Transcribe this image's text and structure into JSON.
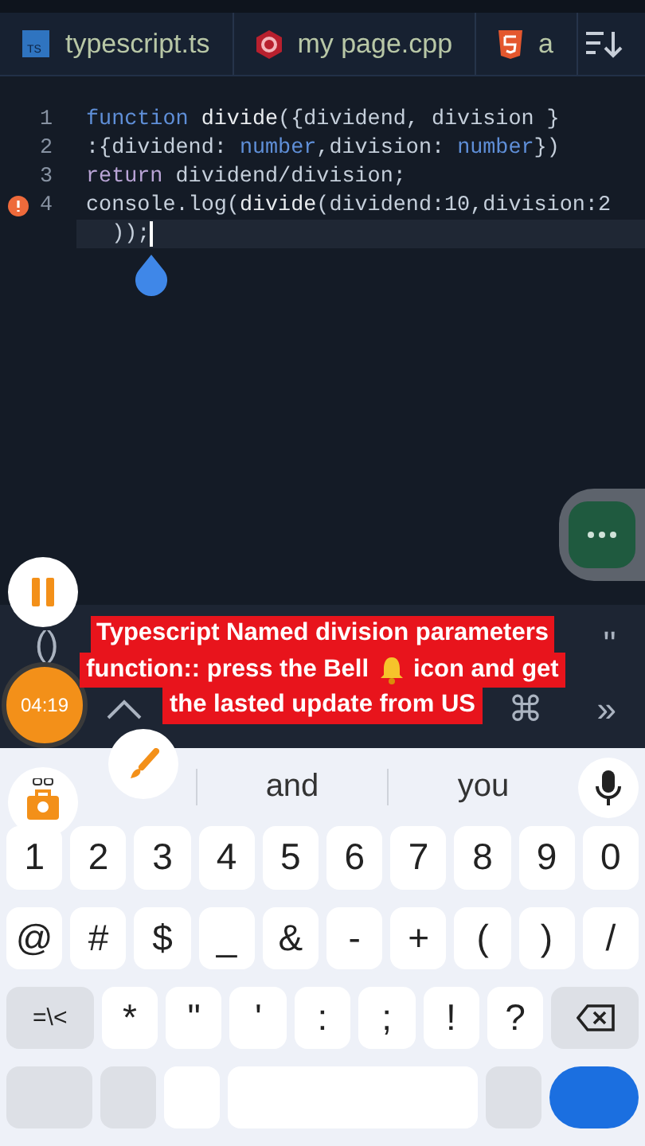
{
  "tabs": [
    {
      "label": "typescript.ts",
      "kind": "ts",
      "icon_text": "TS"
    },
    {
      "label": "my page.cpp",
      "kind": "cpp"
    },
    {
      "label": "a",
      "kind": "html"
    }
  ],
  "editor": {
    "lines": [
      {
        "number": "1",
        "error": false,
        "current": false,
        "tokens": [
          {
            "t": "function ",
            "kind": "keyword"
          },
          {
            "t": "divide",
            "kind": "name"
          },
          {
            "t": "({dividend, division }",
            "kind": "plain"
          }
        ]
      },
      {
        "number": "2",
        "error": false,
        "current": false,
        "tokens": [
          {
            "t": ":{dividend: ",
            "kind": "plain"
          },
          {
            "t": "number",
            "kind": "keyword"
          },
          {
            "t": ",division: ",
            "kind": "plain"
          },
          {
            "t": "number",
            "kind": "keyword"
          },
          {
            "t": "})",
            "kind": "plain"
          }
        ]
      },
      {
        "number": "3",
        "error": false,
        "current": false,
        "tokens": [
          {
            "t": "return ",
            "kind": "control"
          },
          {
            "t": "dividend/division;",
            "kind": "plain"
          }
        ]
      },
      {
        "number": "4",
        "error": true,
        "current": false,
        "tokens": [
          {
            "t": "console.log(",
            "kind": "plain"
          },
          {
            "t": "divide",
            "kind": "name"
          },
          {
            "t": "(dividend:10,division:2",
            "kind": "plain"
          }
        ]
      },
      {
        "error": false,
        "current": true,
        "tokens": [
          {
            "t": "  ));",
            "kind": "plain"
          }
        ]
      }
    ]
  },
  "extra_keys": [
    [
      {
        "label": "()"
      },
      {
        "label": "''"
      }
    ],
    [
      {
        "kind": "chevron"
      },
      {
        "label": "⌘",
        "kind": "text"
      },
      {
        "label": "»",
        "kind": "text"
      }
    ]
  ],
  "caption": [
    [
      {
        "kind": "text",
        "t": "Typescript Named division parameters"
      }
    ],
    [
      {
        "kind": "text",
        "t": "function:: press the Bell"
      },
      {
        "kind": "bell"
      },
      {
        "kind": "text",
        "t": "icon and get"
      }
    ],
    [
      {
        "kind": "text",
        "t": "the lasted update from US"
      }
    ]
  ],
  "timer": "04:19",
  "suggestions": [
    "and",
    "you"
  ],
  "keyboard": [
    [
      {
        "kind": "char",
        "label": "1"
      },
      {
        "kind": "char",
        "label": "2"
      },
      {
        "kind": "char",
        "label": "3"
      },
      {
        "kind": "char",
        "label": "4"
      },
      {
        "kind": "char",
        "label": "5"
      },
      {
        "kind": "char",
        "label": "6"
      },
      {
        "kind": "char",
        "label": "7"
      },
      {
        "kind": "char",
        "label": "8"
      },
      {
        "kind": "char",
        "label": "9"
      },
      {
        "kind": "char",
        "label": "0"
      }
    ],
    [
      {
        "kind": "char",
        "label": "@"
      },
      {
        "kind": "char",
        "label": "#"
      },
      {
        "kind": "char",
        "label": "$"
      },
      {
        "kind": "char",
        "label": "_"
      },
      {
        "kind": "char",
        "label": "&"
      },
      {
        "kind": "char",
        "label": "-"
      },
      {
        "kind": "char",
        "label": "+"
      },
      {
        "kind": "char",
        "label": "("
      },
      {
        "kind": "char",
        "label": ")"
      },
      {
        "kind": "char",
        "label": "/"
      }
    ],
    [
      {
        "kind": "function",
        "label": "=\\<"
      },
      {
        "kind": "char",
        "label": "*"
      },
      {
        "kind": "char",
        "label": "\""
      },
      {
        "kind": "char",
        "label": "'"
      },
      {
        "kind": "char",
        "label": ":"
      },
      {
        "kind": "char",
        "label": ";"
      },
      {
        "kind": "char",
        "label": "!"
      },
      {
        "kind": "char",
        "label": "?"
      },
      {
        "kind": "backspace"
      }
    ],
    [
      {
        "kind": "function"
      },
      {
        "kind": "gray"
      },
      {
        "kind": "char"
      },
      {
        "kind": "space"
      },
      {
        "kind": "gray"
      },
      {
        "kind": "enter"
      }
    ]
  ]
}
